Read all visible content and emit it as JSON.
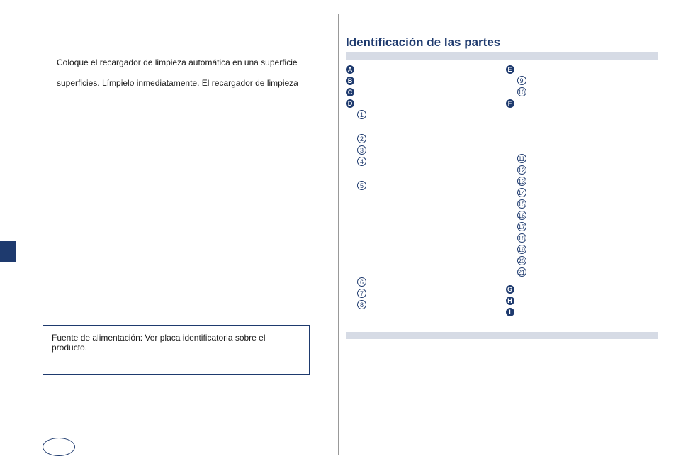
{
  "left": {
    "line1": "Coloque el recargador de limpieza automática en una superficie",
    "line2": "superficies. Límpielo inmediatamente. El recargador de limpieza",
    "spec_line": "Fuente de alimentación: Ver placa identificatoria sobre el producto."
  },
  "right": {
    "title": "Identificación de las partes",
    "letters_col1_top": [
      "A",
      "B",
      "C",
      "D"
    ],
    "nums_col1_a": [
      "1"
    ],
    "nums_col1_b": [
      "2",
      "3",
      "4"
    ],
    "nums_col1_c": [
      "5"
    ],
    "nums_col1_d": [
      "6",
      "7",
      "8"
    ],
    "letters_col2_top": [
      "E"
    ],
    "nums_col2_a": [
      "9",
      "10"
    ],
    "letters_col2_mid": [
      "F"
    ],
    "nums_col2_b": [
      "11",
      "12",
      "13",
      "14",
      "15",
      "16",
      "17",
      "18",
      "19",
      "20",
      "21"
    ],
    "letters_col2_bot": [
      "G",
      "H",
      "I"
    ]
  }
}
